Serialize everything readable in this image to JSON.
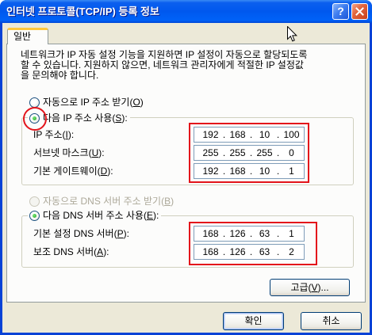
{
  "window": {
    "title": "인터넷 프로토콜(TCP/IP) 등록 정보",
    "help_label": "?"
  },
  "tabs": [
    {
      "label": "일반"
    }
  ],
  "general": {
    "description_lines": [
      "네트워크가 IP 자동 설정 기능을 지원하면 IP 설정이 자동으로 할당되도록",
      "할 수 있습니다. 지원하지 않으면, 네트워크 관리자에게 적절한 IP 설정값",
      "을 문의해야 합니다."
    ],
    "ip_mode": {
      "auto": {
        "label": "자동으로 IP 주소 받기(O)",
        "checked": false,
        "enabled": true
      },
      "manual": {
        "label": "다음 IP 주소 사용(S):",
        "checked": true,
        "enabled": true
      }
    },
    "ip_fields": [
      {
        "label": "IP 주소(I):",
        "octets": [
          "192",
          "168",
          "10",
          "100"
        ]
      },
      {
        "label": "서브넷 마스크(U):",
        "octets": [
          "255",
          "255",
          "255",
          "0"
        ]
      },
      {
        "label": "기본 게이트웨이(D):",
        "octets": [
          "192",
          "168",
          "10",
          "1"
        ]
      }
    ],
    "dns_mode": {
      "auto": {
        "label": "자동으로 DNS 서버 주소 받기(B)",
        "checked": false,
        "enabled": false
      },
      "manual": {
        "label": "다음 DNS 서버 주소 사용(E):",
        "checked": true,
        "enabled": true
      }
    },
    "dns_fields": [
      {
        "label": "기본 설정 DNS 서버(P):",
        "octets": [
          "168",
          "126",
          "63",
          "1"
        ]
      },
      {
        "label": "보조 DNS 서버(A):",
        "octets": [
          "168",
          "126",
          "63",
          "2"
        ]
      }
    ],
    "octet_separator": ".",
    "advanced_button": "고급(V)..."
  },
  "footer": {
    "ok_button": "확인",
    "cancel_button": "취소"
  },
  "icons": {
    "close": "close-icon",
    "cursor": "mouse-cursor-icon"
  },
  "colors": {
    "annotation": "#E3141B",
    "radio_dot": "#21A121",
    "title_bar": "#0058EE",
    "dialog_background": "#ECE9D8",
    "disabled_text": "#ACA899"
  }
}
